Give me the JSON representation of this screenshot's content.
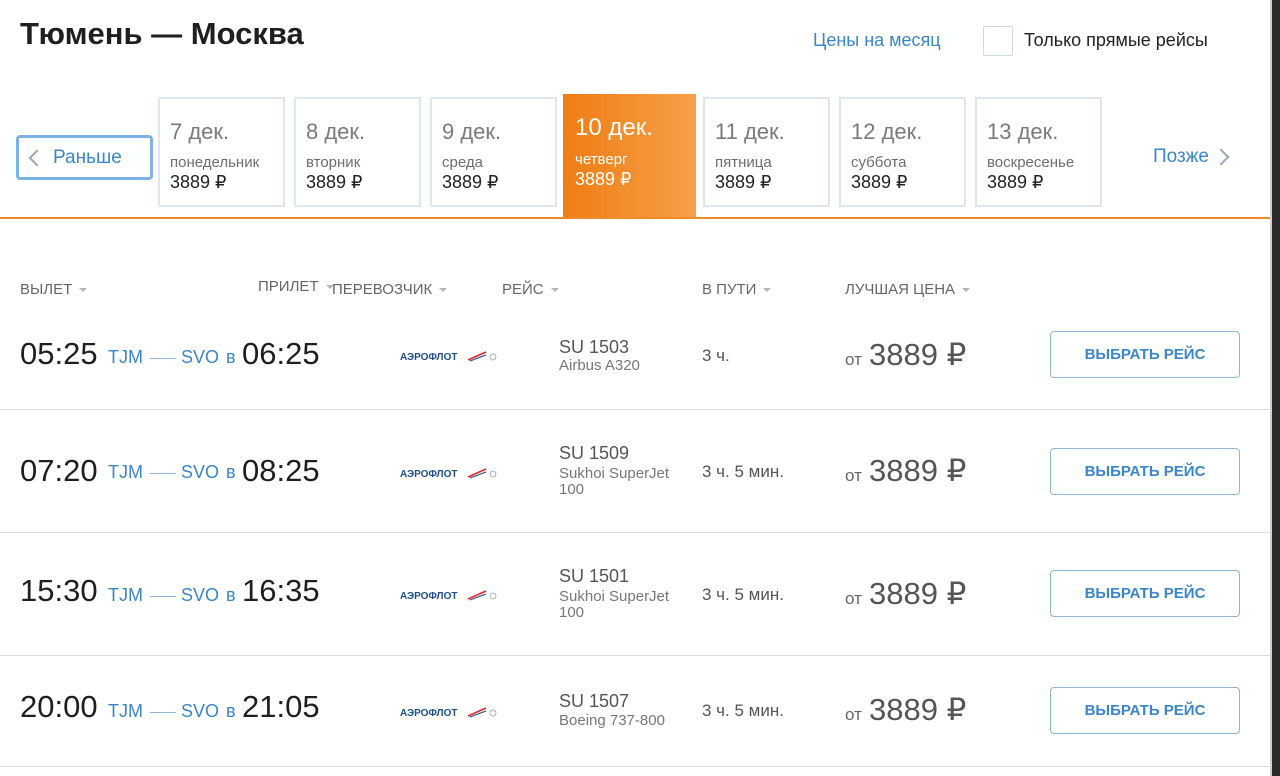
{
  "header": {
    "route_title": "Тюмень — Москва",
    "month_prices_link": "Цены на месяц",
    "direct_only_label": "Только прямые рейсы",
    "direct_only_checked": false
  },
  "date_nav": {
    "earlier_label": "Раньше",
    "later_label": "Позже",
    "dates": [
      {
        "day": "7 дек.",
        "weekday": "понедельник",
        "price": "3889 ₽",
        "active": false
      },
      {
        "day": "8 дек.",
        "weekday": "вторник",
        "price": "3889 ₽",
        "active": false
      },
      {
        "day": "9 дек.",
        "weekday": "среда",
        "price": "3889 ₽",
        "active": false
      },
      {
        "day": "10 дек.",
        "weekday": "четверг",
        "price": "3889 ₽",
        "active": true
      },
      {
        "day": "11 дек.",
        "weekday": "пятница",
        "price": "3889 ₽",
        "active": false
      },
      {
        "day": "12 дек.",
        "weekday": "суббота",
        "price": "3889 ₽",
        "active": false
      },
      {
        "day": "13 дек.",
        "weekday": "воскресенье",
        "price": "3889 ₽",
        "active": false
      }
    ]
  },
  "table": {
    "headers": {
      "departure": "ВЫЛЕТ",
      "arrival": "ПРИЛЕТ",
      "carrier": "ПЕРЕВОЗЧИК",
      "flight": "РЕЙС",
      "duration": "В ПУТИ",
      "best_price": "ЛУЧШАЯ ЦЕНА"
    },
    "rows": [
      {
        "dep_time": "05:25",
        "dep_airport": "TJM",
        "arr_airport": "SVO",
        "in_word": "в",
        "arr_time": "06:25",
        "carrier_logo": "АЭРОФЛОТ",
        "flight_no": "SU 1503",
        "aircraft": "Airbus A320",
        "duration": "3 ч.",
        "from_label": "от",
        "price": "3889 ₽",
        "select_label": "ВЫБРАТЬ РЕЙС"
      },
      {
        "dep_time": "07:20",
        "dep_airport": "TJM",
        "arr_airport": "SVO",
        "in_word": "в",
        "arr_time": "08:25",
        "carrier_logo": "АЭРОФЛОТ",
        "flight_no": "SU 1509",
        "aircraft": "Sukhoi SuperJet 100",
        "duration": "3 ч. 5 мин.",
        "from_label": "от",
        "price": "3889 ₽",
        "select_label": "ВЫБРАТЬ РЕЙС"
      },
      {
        "dep_time": "15:30",
        "dep_airport": "TJM",
        "arr_airport": "SVO",
        "in_word": "в",
        "arr_time": "16:35",
        "carrier_logo": "АЭРОФЛОТ",
        "flight_no": "SU 1501",
        "aircraft": "Sukhoi SuperJet 100",
        "duration": "3 ч. 5 мин.",
        "from_label": "от",
        "price": "3889 ₽",
        "select_label": "ВЫБРАТЬ РЕЙС"
      },
      {
        "dep_time": "20:00",
        "dep_airport": "TJM",
        "arr_airport": "SVO",
        "in_word": "в",
        "arr_time": "21:05",
        "carrier_logo": "АЭРОФЛОТ",
        "flight_no": "SU 1507",
        "aircraft": "Boeing 737-800",
        "duration": "3 ч. 5 мин.",
        "from_label": "от",
        "price": "3889 ₽",
        "select_label": "ВЫБРАТЬ РЕЙС"
      }
    ]
  },
  "colors": {
    "accent_orange": "#ef7d14",
    "link_blue": "#3a86c8",
    "logo_red": "#e3262c"
  }
}
